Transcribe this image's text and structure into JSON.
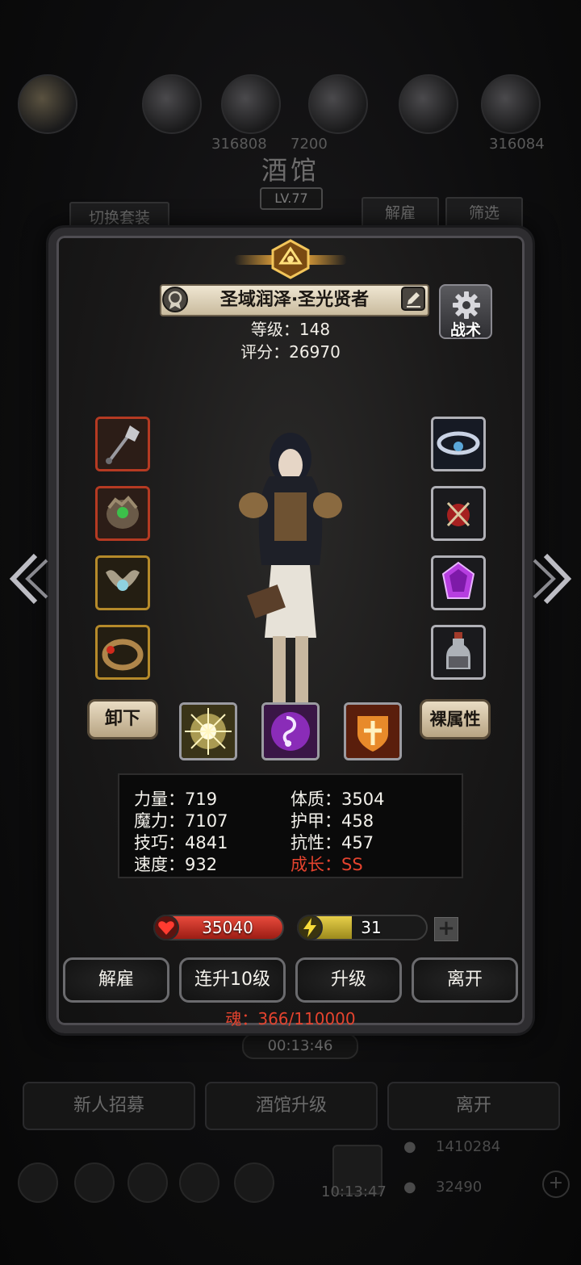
{
  "background": {
    "title": "酒馆",
    "level_badge": "LV.77",
    "switch_outfit": "切换套装",
    "dismiss": "解雇",
    "filter": "筛选",
    "resource_left": "316808",
    "resource_mid": "7200",
    "resource_right": "316084",
    "timer": "00:13:46",
    "bottom_buttons": [
      "新人招募",
      "酒馆升级",
      "离开"
    ],
    "gold": "1410284",
    "gems": "32490",
    "clock": "10:13:47"
  },
  "hero": {
    "name": "圣域润泽·圣光贤者",
    "level_text": "等级：148",
    "score_text": "评分：26970",
    "tactics_label": "战术"
  },
  "equipment": {
    "left": [
      {
        "icon": "mace-icon",
        "rarity": "red"
      },
      {
        "icon": "gauntlet-icon",
        "rarity": "red"
      },
      {
        "icon": "amulet-icon",
        "rarity": "gold"
      },
      {
        "icon": "ring-icon",
        "rarity": "gold"
      }
    ],
    "right": [
      {
        "icon": "crown-icon",
        "rarity": "silver"
      },
      {
        "icon": "charm-icon",
        "rarity": "silver"
      },
      {
        "icon": "purple-gem-icon",
        "rarity": "silver"
      },
      {
        "icon": "potion-bottle-icon",
        "rarity": "silver"
      }
    ]
  },
  "controls": {
    "unequip": "卸下",
    "base_attributes": "裸属性"
  },
  "skills": [
    {
      "icon": "light-burst-icon"
    },
    {
      "icon": "music-note-icon"
    },
    {
      "icon": "holy-shield-icon"
    }
  ],
  "stats": {
    "strength": "力量：719",
    "constitution": "体质：3504",
    "magic": "魔力：7107",
    "armor": "护甲：458",
    "skill": "技巧：4841",
    "resistance": "抗性：457",
    "speed": "速度：932",
    "growth": "成长：SS"
  },
  "vitals": {
    "hp": "35040",
    "energy": "31",
    "energy_level": 0.42,
    "hp_color": "#c4281c",
    "energy_color": "#d7be3a"
  },
  "actions": {
    "dismiss": "解雇",
    "upgrade_10": "连升10级",
    "upgrade": "升级",
    "leave": "离开"
  },
  "soul_text": "魂：366/110000",
  "colors": {
    "accent_gold": "#e7a53b",
    "growth_red": "#e4432e"
  }
}
